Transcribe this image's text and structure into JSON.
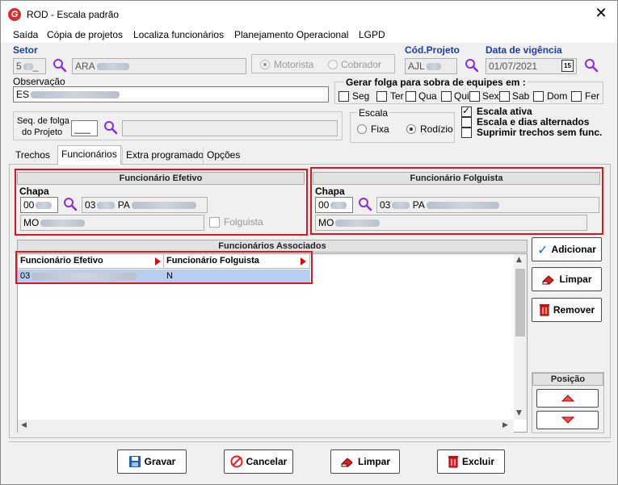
{
  "window": {
    "title": "ROD - Escala padrão",
    "logo_letter": "G",
    "close_glyph": "✕"
  },
  "menu": [
    "Saída",
    "Cópia de projetos",
    "Localiza funcionários",
    "Planejamento Operacional",
    "LGPD"
  ],
  "setor": {
    "label": "Setor",
    "code": "5",
    "code_suffix": "_",
    "name": "ARA"
  },
  "tipo": {
    "options": [
      {
        "label": "Motorista",
        "selected": true
      },
      {
        "label": "Cobrador",
        "selected": false
      }
    ]
  },
  "cod_projeto": {
    "label": "Cód.Projeto",
    "value": "AJL"
  },
  "data_vigencia": {
    "label": "Data de vigência",
    "value": "01/07/2021",
    "calendar_glyph": "15"
  },
  "observacao": {
    "label": "Observação",
    "value": "ES"
  },
  "folga_equipes": {
    "title": "Gerar folga para sobra de equipes em :",
    "days": [
      {
        "label": "Seg",
        "checked": false
      },
      {
        "label": "Ter",
        "checked": false
      },
      {
        "label": "Qua",
        "checked": false
      },
      {
        "label": "Qui",
        "checked": false
      },
      {
        "label": "Sex",
        "checked": false
      },
      {
        "label": "Sab",
        "checked": false
      },
      {
        "label": "Dom",
        "checked": false
      },
      {
        "label": "Fer",
        "checked": false
      }
    ]
  },
  "seq_folga": {
    "label_line1": "Seq. de folga",
    "label_line2": "do Projeto",
    "value": "___"
  },
  "escala": {
    "title": "Escala",
    "options": [
      {
        "label": "Fixa",
        "selected": false
      },
      {
        "label": "Rodízio",
        "selected": true
      }
    ]
  },
  "flags": [
    {
      "label": "Escala ativa",
      "checked": true
    },
    {
      "label": "Escala e dias alternados",
      "checked": false
    },
    {
      "label": "Suprimir trechos sem func.",
      "checked": false
    }
  ],
  "tabs": [
    "Trechos",
    "Funcionários",
    "Extra programado",
    "Opções"
  ],
  "efetivo": {
    "header": "Funcionário Efetivo",
    "chapa_label": "Chapa",
    "chapa": "00",
    "code": "03",
    "name": "PA",
    "name2": "MO",
    "folguista_label": "Folguista",
    "folguista_checked": false
  },
  "folguista": {
    "header": "Funcionário Folguista",
    "chapa_label": "Chapa",
    "chapa": "00",
    "code": "03",
    "name": "PA",
    "name2": "MO"
  },
  "associados": {
    "header": "Funcionários Associados",
    "columns": [
      "Funcionário Efetivo",
      "Funcionário Folguista"
    ],
    "rows": [
      {
        "efetivo": "03",
        "folguista": "N"
      }
    ]
  },
  "side_buttons": {
    "adicionar": "Adicionar",
    "limpar": "Limpar",
    "remover": "Remover"
  },
  "posicao": {
    "title": "Posição"
  },
  "bottom_buttons": {
    "gravar": "Gravar",
    "cancelar": "Cancelar",
    "limpar": "Limpar",
    "excluir": "Excluir"
  },
  "colors": {
    "label_blue": "#1c3aa9",
    "highlight_red": "#e0141c",
    "search_purple": "#8a2be2",
    "selected_row": "#b9cdf0"
  }
}
